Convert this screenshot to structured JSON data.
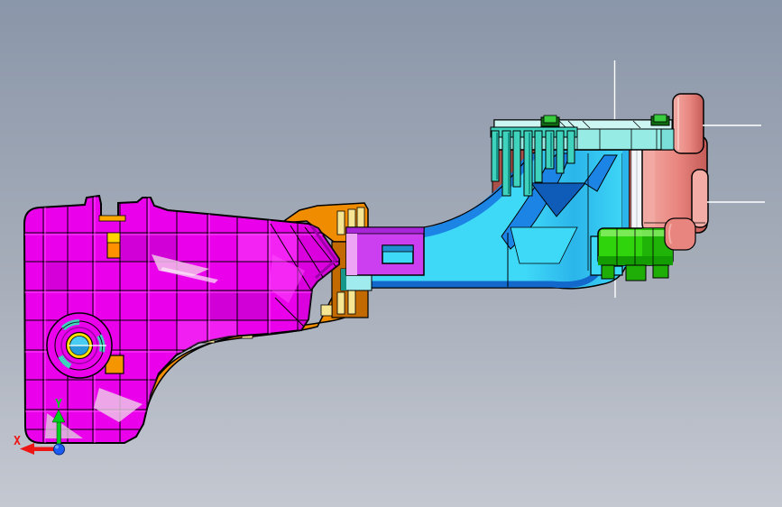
{
  "viewport": {
    "type": "cad-3d-view",
    "axis_triad": {
      "x_label": "X",
      "y_label": "Y"
    }
  },
  "colors": {
    "background_top": "#8a96a9",
    "background_mid": "#a7aeba",
    "background_bottom": "#c4c8d1",
    "crosshair": "#ffffff",
    "bracket": "#ea00ea",
    "bracket_shadow": "#c000c8",
    "bracket_highlight": "#ff4dff",
    "bracket_deep": "#9c00a8",
    "orange": "#f08c00",
    "orange_dark": "#c26a00",
    "orange_pale": "#f6e694",
    "purple": "#cb3ff0",
    "purple_light": "#eda4f5",
    "purple_dark": "#a826d8",
    "arm_cyan": "#3fd9f8",
    "arm_cyan_dark": "#2bb5ea",
    "arm_blue": "#1b84e4",
    "arm_darkblue": "#0e5cb8",
    "arm_bottom": "#1368cc",
    "plate_light": "#cdf6f3",
    "plate_mid": "#96ebe5",
    "plate_step": "#7adfd8",
    "comb_teal": "#3fd2bd",
    "comb_dark": "#17968a",
    "screw_green": "#39cc3f",
    "screw_dark": "#0f6b12",
    "salmon": "#e9857f",
    "salmon_light": "#f3aca6",
    "salmon_dark": "#c45b57",
    "brick": "#ab5149",
    "brick_light": "#d4766e",
    "white_part": "#f4f7f9",
    "gear_green": "#2fd40c",
    "gear_green_mid": "#1fae08",
    "gear_green_dark": "#149c03",
    "gear_green_hi": "#8df06a",
    "hub_yellow": "#ffdf00",
    "hub_cyan": "#49ccf2",
    "hub_cyan_dark": "#1f8fd0",
    "pale_cyan_block": "#9febee",
    "axis_x": "#ee1515",
    "axis_y": "#00cf1f",
    "axis_z": "#1a5cf4"
  }
}
